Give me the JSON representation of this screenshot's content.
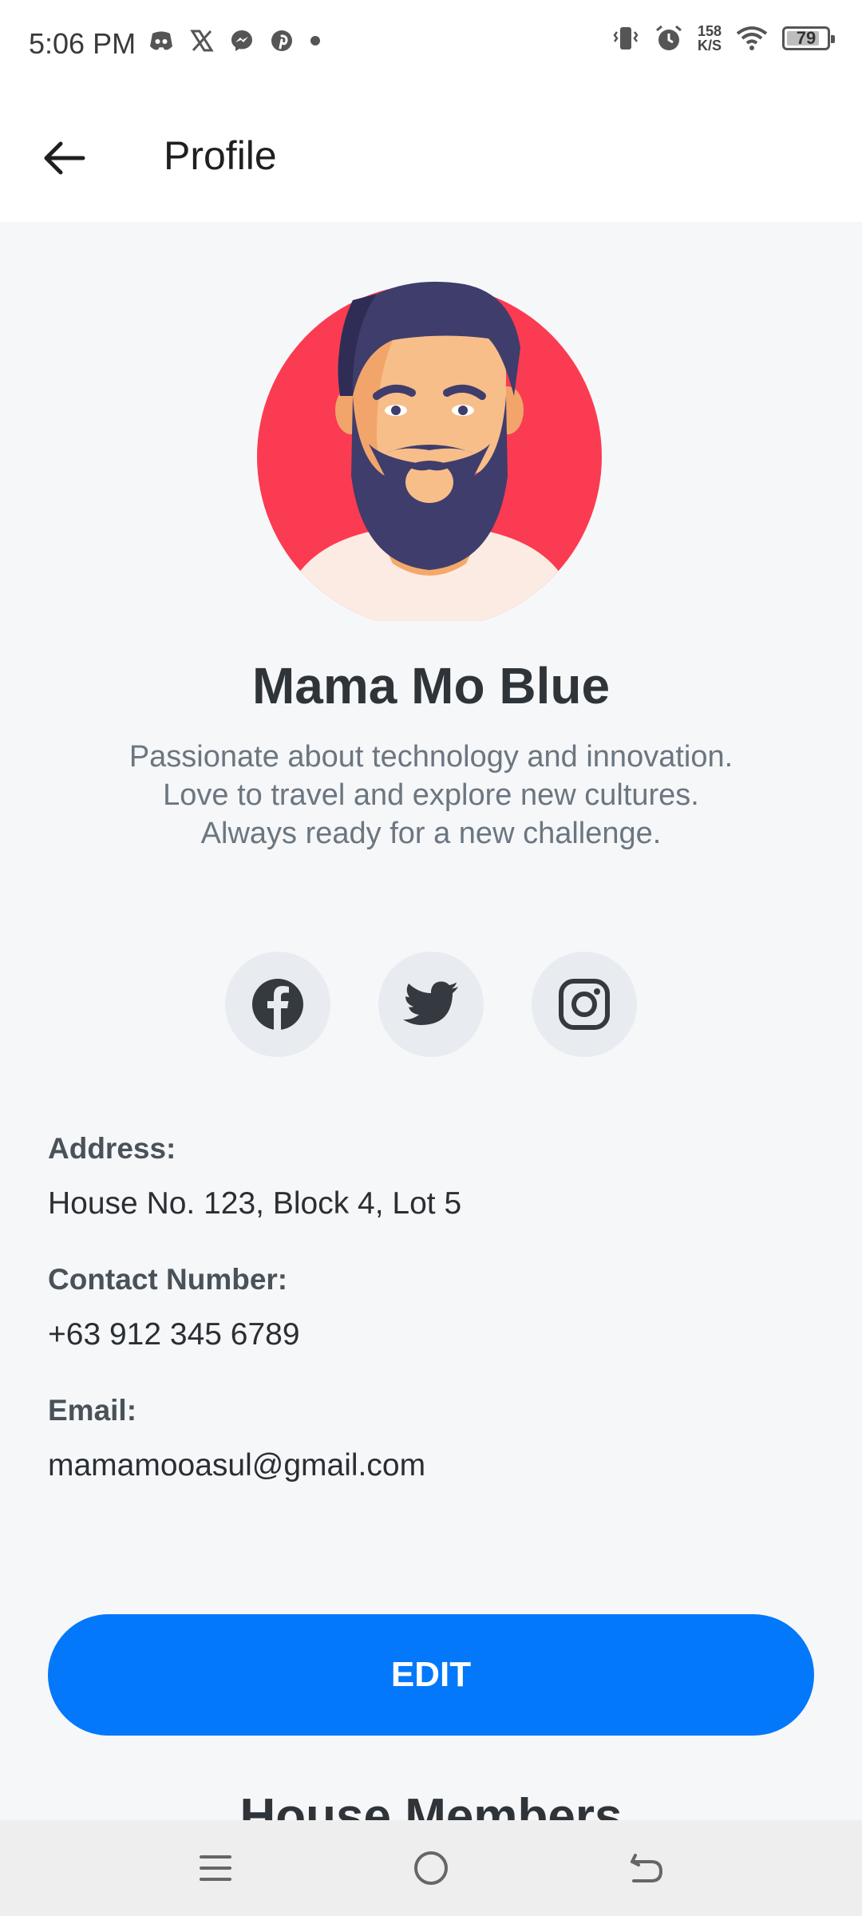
{
  "status_bar": {
    "time": "5:06 PM",
    "notification_icons": [
      "discord-icon",
      "x-icon",
      "messenger-icon",
      "pinterest-icon",
      "dot-icon"
    ],
    "network_speed_value": "158",
    "network_speed_unit": "K/S",
    "battery": "79"
  },
  "app_bar": {
    "title": "Profile"
  },
  "profile": {
    "name": "Mama Mo Blue",
    "bio": [
      "Passionate about technology and innovation.",
      "Love to travel and explore new cultures.",
      "Always ready for a new challenge."
    ],
    "avatar_bg_color": "#fb3b51"
  },
  "socials": [
    "facebook-icon",
    "twitter-icon",
    "instagram-icon"
  ],
  "info": {
    "address_label": "Address:",
    "address_value": "House No. 123, Block 4, Lot 5",
    "contact_label": "Contact Number:",
    "contact_value": "+63 912 345 6789",
    "email_label": "Email:",
    "email_value": "mamamooasul@gmail.com"
  },
  "edit_button": {
    "label": "EDIT",
    "color": "#0478fb"
  },
  "house_members": {
    "title": "House Members"
  },
  "nav_bar": {
    "buttons": [
      "menu-icon",
      "home-icon",
      "back-icon"
    ]
  }
}
